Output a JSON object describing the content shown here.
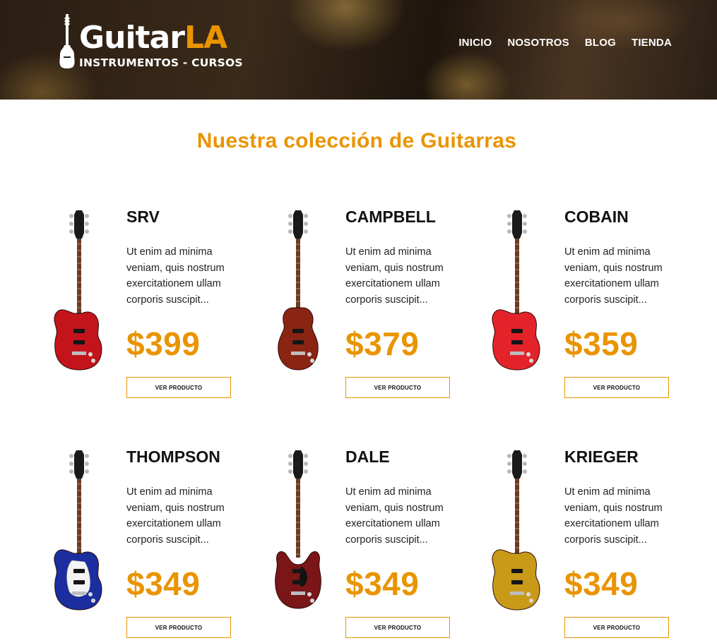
{
  "logo": {
    "name_white": "Guitar",
    "name_orange": "LA",
    "subtitle": "INSTRUMENTOS - CURSOS"
  },
  "nav": [
    "INICIO",
    "NOSOTROS",
    "BLOG",
    "TIENDA"
  ],
  "main": {
    "title": "Nuestra colección de Guitarras"
  },
  "products": [
    {
      "name": "SRV",
      "description": "Ut enim ad minima veniam, quis nostrum exercitationem ullam corporis suscipit...",
      "price": "$399",
      "button": "VER PRODUCTO",
      "body_color": "#c3141c",
      "style": "strat",
      "guard": "none"
    },
    {
      "name": "CAMPBELL",
      "description": "Ut enim ad minima veniam, quis nostrum exercitationem ullam corporis suscipit...",
      "price": "$379",
      "button": "VER PRODUCTO",
      "body_color": "#8a2413",
      "style": "lespaul",
      "guard": "none"
    },
    {
      "name": "COBAIN",
      "description": "Ut enim ad minima veniam, quis nostrum exercitationem ullam corporis suscipit...",
      "price": "$359",
      "button": "VER PRODUCTO",
      "body_color": "#e3222a",
      "style": "strat",
      "guard": "none"
    },
    {
      "name": "THOMPSON",
      "description": "Ut enim ad minima veniam, quis nostrum exercitationem ullam corporis suscipit...",
      "price": "$349",
      "button": "VER PRODUCTO",
      "body_color": "#1a2ea0",
      "style": "strat",
      "guard": "white"
    },
    {
      "name": "DALE",
      "description": "Ut enim ad minima veniam, quis nostrum exercitationem ullam corporis suscipit...",
      "price": "$349",
      "button": "VER PRODUCTO",
      "body_color": "#7a1618",
      "style": "sg",
      "guard": "black"
    },
    {
      "name": "KRIEGER",
      "description": "Ut enim ad minima veniam, quis nostrum exercitationem ullam corporis suscipit...",
      "price": "$349",
      "button": "VER PRODUCTO",
      "body_color": "#c99a18",
      "style": "strat",
      "guard": "none"
    }
  ]
}
